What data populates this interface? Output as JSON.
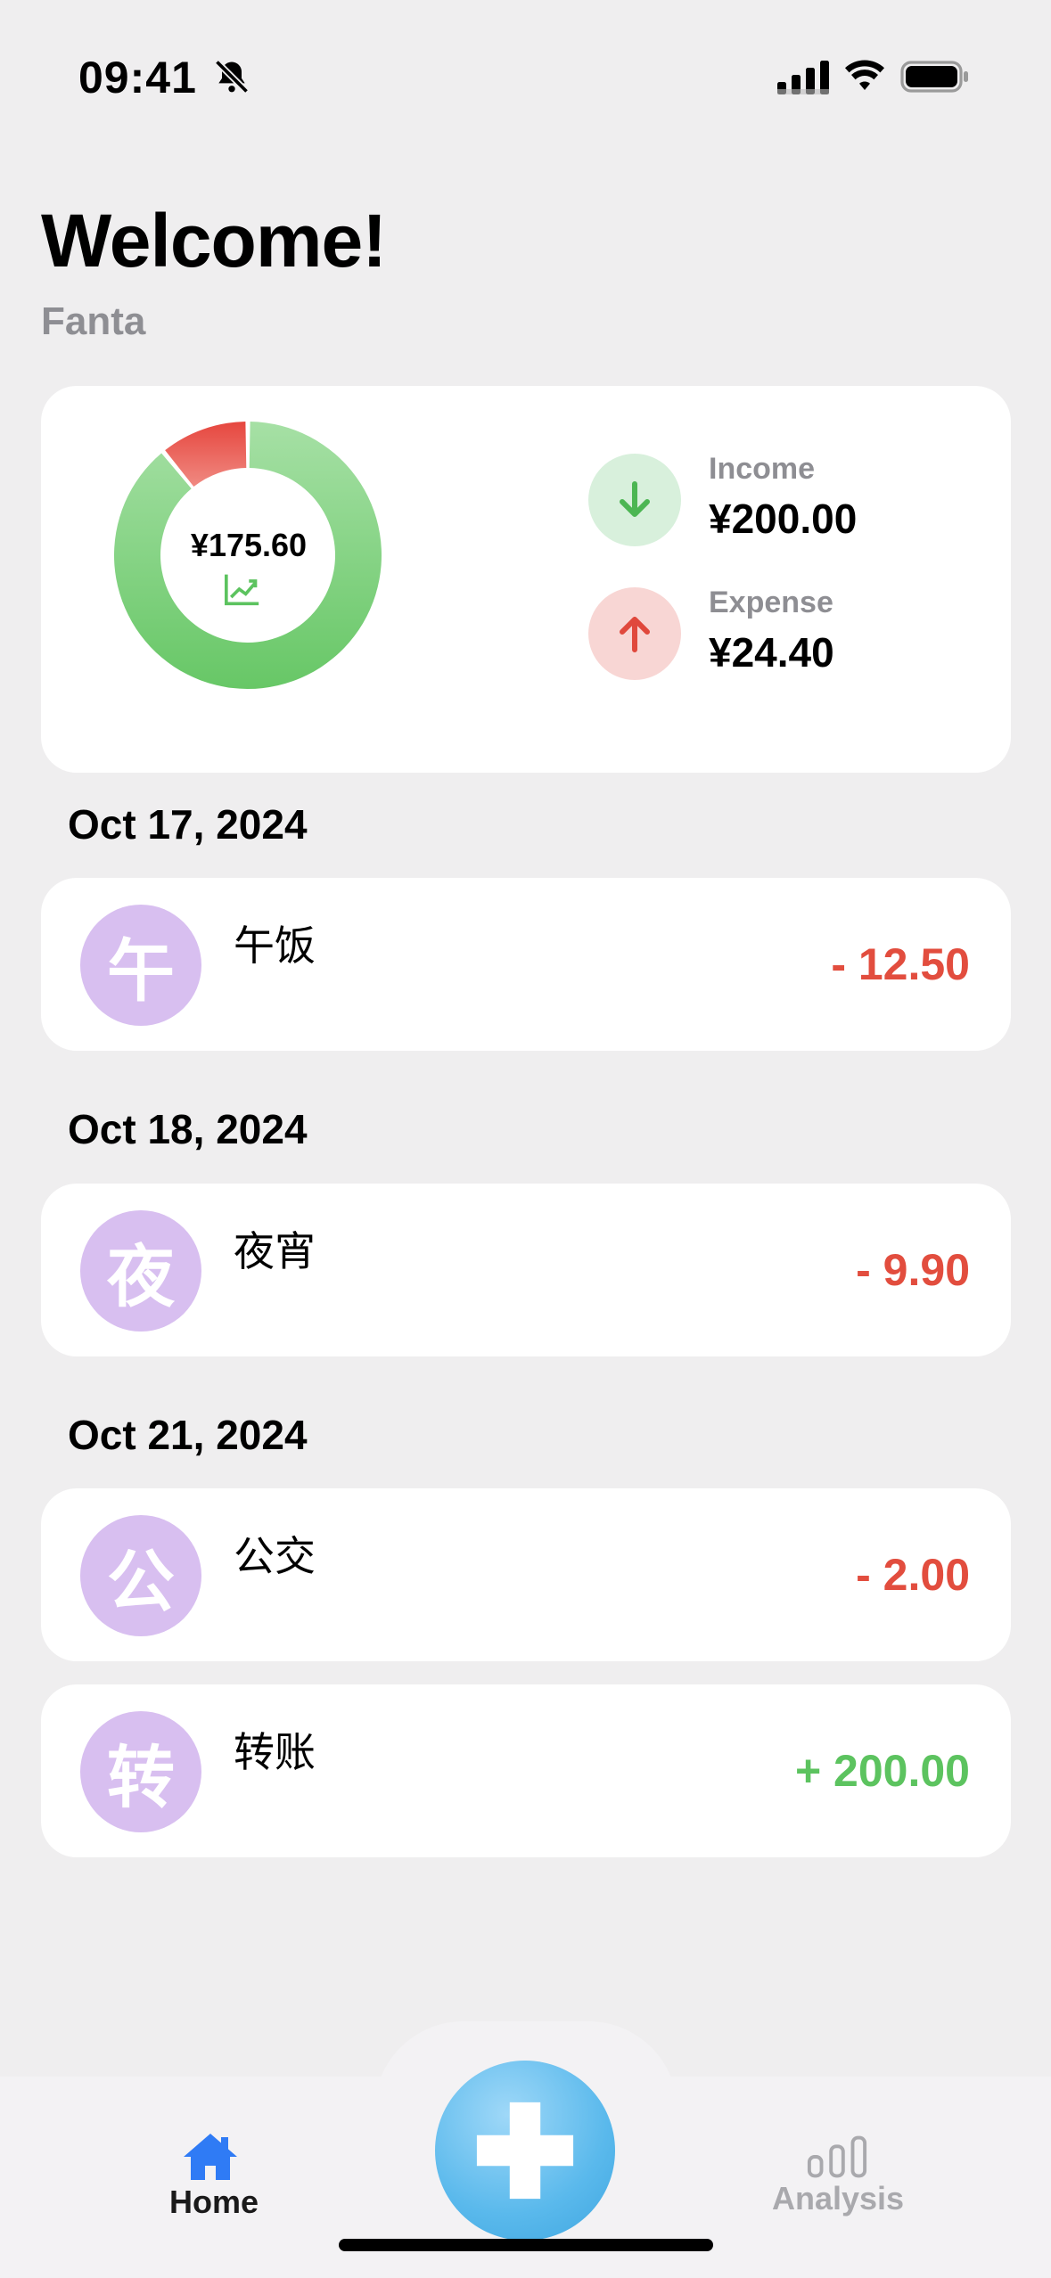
{
  "status_bar": {
    "time": "09:41"
  },
  "header": {
    "title": "Welcome!",
    "username": "Fanta"
  },
  "summary": {
    "balance": "¥175.60",
    "income_label": "Income",
    "income_amount": "¥200.00",
    "expense_label": "Expense",
    "expense_amount": "¥24.40",
    "income_fraction": 0.891,
    "expense_fraction": 0.109,
    "colors": {
      "income": "#6cc96b",
      "expense": "#e65a4d"
    }
  },
  "groups": [
    {
      "date": "Oct 17, 2024",
      "items": [
        {
          "glyph": "午",
          "name": "午饭",
          "amount": "- 12.50",
          "kind": "expense"
        }
      ]
    },
    {
      "date": "Oct 18, 2024",
      "items": [
        {
          "glyph": "夜",
          "name": "夜宵",
          "amount": "- 9.90",
          "kind": "expense"
        }
      ]
    },
    {
      "date": "Oct 21, 2024",
      "items": [
        {
          "glyph": "公",
          "name": "公交",
          "amount": "- 2.00",
          "kind": "expense"
        },
        {
          "glyph": "转",
          "name": "转账",
          "amount": "+ 200.00",
          "kind": "income"
        }
      ]
    }
  ],
  "tabbar": {
    "home_label": "Home",
    "analysis_label": "Analysis",
    "add_icon": "plus-icon"
  }
}
